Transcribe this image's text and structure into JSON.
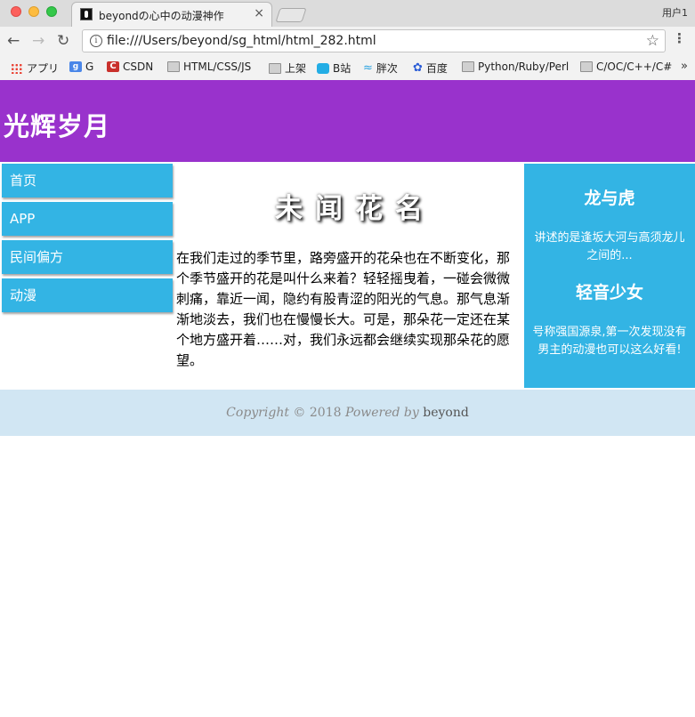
{
  "browser": {
    "tab_title": "beyondの心中の动漫神作",
    "tab_close": "×",
    "profile": "用户1",
    "url": "file:///Users/beyond/sg_html/html_282.html",
    "bookmarks": [
      {
        "label": "アプリ",
        "icon": "apps-grid-icon"
      },
      {
        "label": "G",
        "icon": "google-translate-icon"
      },
      {
        "label": "CSDN",
        "icon": "csdn-icon"
      },
      {
        "label": "HTML/CSS/JS",
        "icon": "folder-icon"
      },
      {
        "label": "上架",
        "icon": "folder-icon"
      },
      {
        "label": "B站",
        "icon": "bilibili-icon"
      },
      {
        "label": "胖次",
        "icon": "wave-icon"
      },
      {
        "label": "百度",
        "icon": "baidu-paw-icon"
      },
      {
        "label": "Python/Ruby/Perl",
        "icon": "folder-icon"
      },
      {
        "label": "C/OC/C++/C#",
        "icon": "folder-icon"
      }
    ],
    "bookmarks_more": "»"
  },
  "page": {
    "site_title": "光辉岁月",
    "nav": [
      {
        "label": "首页"
      },
      {
        "label": "APP"
      },
      {
        "label": "民间偏方"
      },
      {
        "label": "动漫"
      }
    ],
    "main": {
      "title": "未闻花名",
      "text": "在我们走过的季节里，路旁盛开的花朵也在不断变化，那个季节盛开的花是叫什么来着？轻轻摇曳着，一碰会微微刺痛，靠近一闻，隐约有股青涩的阳光的气息。那气息渐渐地淡去，我们也在慢慢长大。可是，那朵花一定还在某个地方盛开着……对，我们永远都会继续实现那朵花的愿望。"
    },
    "aside": [
      {
        "title": "龙与虎",
        "text": "讲述的是逢坂大河与高须龙儿之间的..."
      },
      {
        "title": "轻音少女",
        "text": "号称强国源泉,第一次发现没有男主的动漫也可以这么好看!"
      }
    ],
    "footer": {
      "copyright": "Copyright ©",
      "year": "2018",
      "powered": "Powered by",
      "author": "beyond"
    }
  },
  "colors": {
    "header": "#9932cc",
    "accent": "#33b4e4",
    "footer": "#d1e6f3"
  }
}
